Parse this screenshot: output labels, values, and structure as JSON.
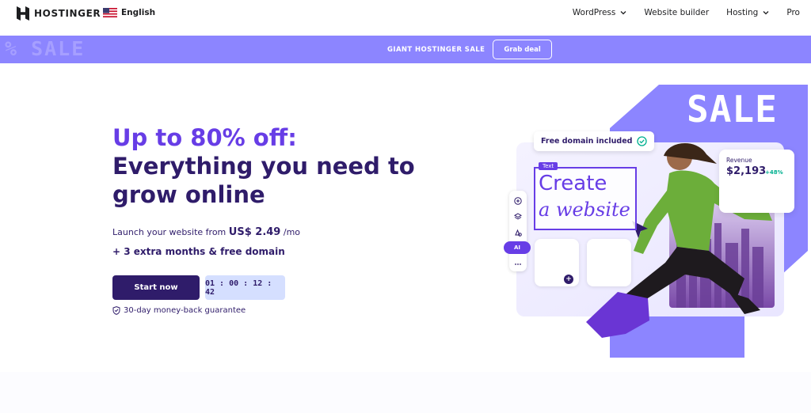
{
  "nav": {
    "brand": "HOSTINGER",
    "language": "English",
    "links": [
      {
        "label": "WordPress",
        "has_dropdown": true
      },
      {
        "label": "Website builder",
        "has_dropdown": false
      },
      {
        "label": "Hosting",
        "has_dropdown": true
      },
      {
        "label": "Pro",
        "has_dropdown": false
      }
    ]
  },
  "promo": {
    "deco_symbol": "%",
    "deco_word": "SALE",
    "text": "GIANT HOSTINGER SALE",
    "button": "Grab deal",
    "background": "#8c85ff"
  },
  "hero": {
    "headline_accent": "Up to 80% off:",
    "headline_line2": "Everything you need to",
    "headline_line3": "grow online",
    "launch_prefix": "Launch your website from",
    "price": "US$ 2.49",
    "price_period": "/mo",
    "extra": "+ 3 extra months & free domain",
    "cta": "Start now",
    "countdown": "01 : 00 : 12 : 42",
    "guarantee": "30-day money-back guarantee"
  },
  "art": {
    "sale_word": "SALE",
    "free_domain": "Free domain included",
    "text_tag": "Text",
    "create_line1": "Create",
    "create_line2": "a website",
    "ai_label": "AI",
    "revenue_label": "Revenue",
    "revenue_value": "$2,193",
    "revenue_change": "+48%"
  },
  "colors": {
    "brand_purple": "#673de6",
    "dark_navy": "#2f1c6a",
    "timer_bg": "#d5dfff",
    "art_purple": "#8c85ff"
  }
}
